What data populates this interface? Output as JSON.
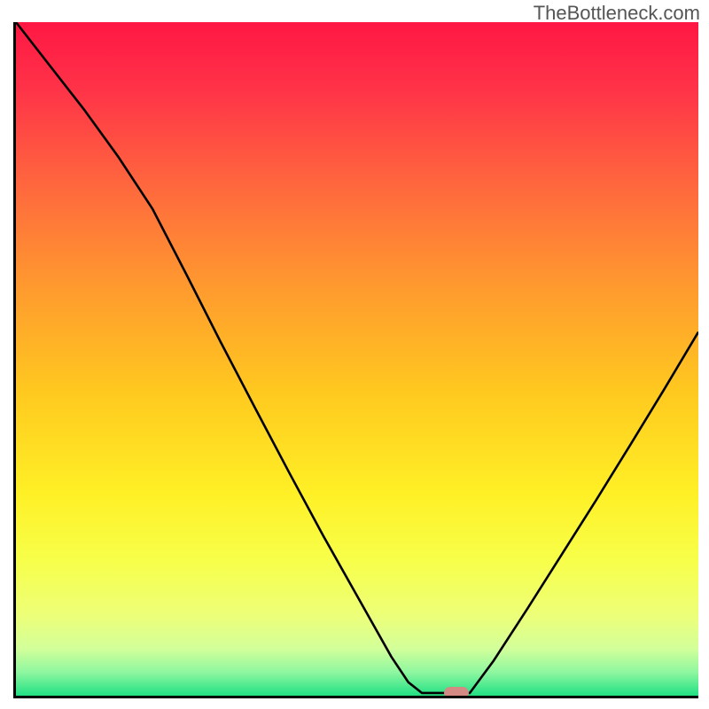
{
  "watermark": "TheBottleneck.com",
  "chart_data": {
    "type": "line",
    "title": "",
    "xlabel": "",
    "ylabel": "",
    "x_range": [
      0,
      100
    ],
    "y_range": [
      0,
      100
    ],
    "curve_normalized": [
      {
        "x": 0.0,
        "y": 1.0
      },
      {
        "x": 0.05,
        "y": 0.935
      },
      {
        "x": 0.1,
        "y": 0.87
      },
      {
        "x": 0.15,
        "y": 0.8
      },
      {
        "x": 0.2,
        "y": 0.723
      },
      {
        "x": 0.25,
        "y": 0.625
      },
      {
        "x": 0.3,
        "y": 0.525
      },
      {
        "x": 0.35,
        "y": 0.428
      },
      {
        "x": 0.4,
        "y": 0.332
      },
      {
        "x": 0.45,
        "y": 0.238
      },
      {
        "x": 0.5,
        "y": 0.148
      },
      {
        "x": 0.55,
        "y": 0.058
      },
      {
        "x": 0.575,
        "y": 0.02
      },
      {
        "x": 0.595,
        "y": 0.004
      },
      {
        "x": 0.635,
        "y": 0.004
      },
      {
        "x": 0.665,
        "y": 0.004
      },
      {
        "x": 0.7,
        "y": 0.052
      },
      {
        "x": 0.75,
        "y": 0.13
      },
      {
        "x": 0.8,
        "y": 0.21
      },
      {
        "x": 0.85,
        "y": 0.29
      },
      {
        "x": 0.9,
        "y": 0.372
      },
      {
        "x": 0.95,
        "y": 0.455
      },
      {
        "x": 1.0,
        "y": 0.54
      }
    ],
    "marker": {
      "x_norm": 0.645,
      "y_norm": 0.004,
      "color": "#d48a84"
    },
    "gradient_stops": [
      {
        "offset": 0.0,
        "color": "#ff1744"
      },
      {
        "offset": 0.1,
        "color": "#ff3348"
      },
      {
        "offset": 0.25,
        "color": "#ff6a3d"
      },
      {
        "offset": 0.4,
        "color": "#ff9c2e"
      },
      {
        "offset": 0.55,
        "color": "#ffc91f"
      },
      {
        "offset": 0.7,
        "color": "#fff026"
      },
      {
        "offset": 0.8,
        "color": "#f7ff4a"
      },
      {
        "offset": 0.88,
        "color": "#edff78"
      },
      {
        "offset": 0.93,
        "color": "#d3ff9a"
      },
      {
        "offset": 0.965,
        "color": "#8ef7a0"
      },
      {
        "offset": 1.0,
        "color": "#22e084"
      }
    ]
  }
}
